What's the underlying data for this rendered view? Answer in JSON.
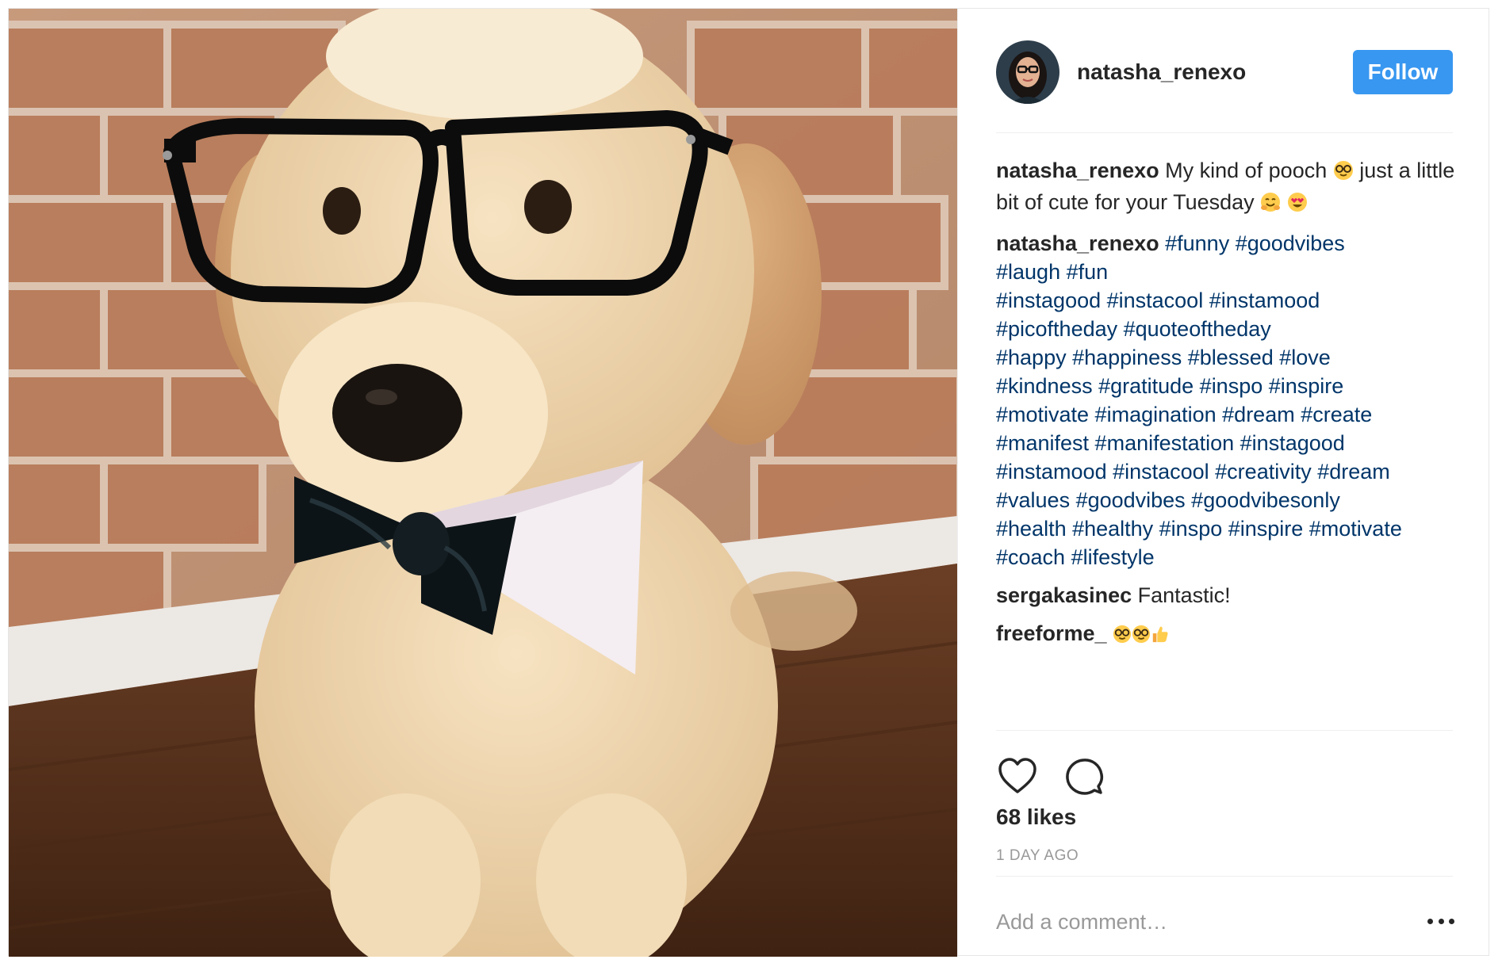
{
  "post": {
    "username": "natasha_renexo",
    "follow_label": "Follow",
    "caption": {
      "user": "natasha_renexo",
      "text_before_emoji": "My kind of pooch",
      "text_after_emoji": "just a little bit of cute for your Tuesday",
      "emojis": [
        "nerd-face-emoji",
        "hugging-face-emoji",
        "heart-eyes-emoji"
      ]
    },
    "hashtag_comment": {
      "user": "natasha_renexo",
      "lines": [
        "#funny #goodvibes",
        "#laugh #fun",
        "#instagood #instacool #instamood",
        "#picoftheday #quoteoftheday",
        "#happy #happiness #blessed #love",
        "#kindness #gratitude #inspo #inspire",
        "#motivate #imagination #dream #create",
        "#manifest #manifestation #instagood",
        "#instamood #instacool #creativity #dream",
        "#values #goodvibes #goodvibesonly",
        "#health #healthy #inspo #inspire #motivate",
        "#coach #lifestyle"
      ]
    },
    "comments": [
      {
        "user": "sergakasinec",
        "text": "Fantastic!"
      },
      {
        "user": "freeforme_",
        "text": "",
        "emojis": [
          "nerd-face-emoji",
          "nerd-face-emoji",
          "thumbs-up-emoji"
        ]
      }
    ],
    "likes": "68 likes",
    "timestamp": "1 DAY AGO",
    "comment_placeholder": "Add a comment…"
  },
  "colors": {
    "follow_button": "#3897f0",
    "hashtag": "#003569",
    "text": "#262626",
    "muted": "#999999",
    "border": "#efefef"
  },
  "icons": [
    "heart-icon",
    "comment-icon",
    "more-options-icon"
  ]
}
